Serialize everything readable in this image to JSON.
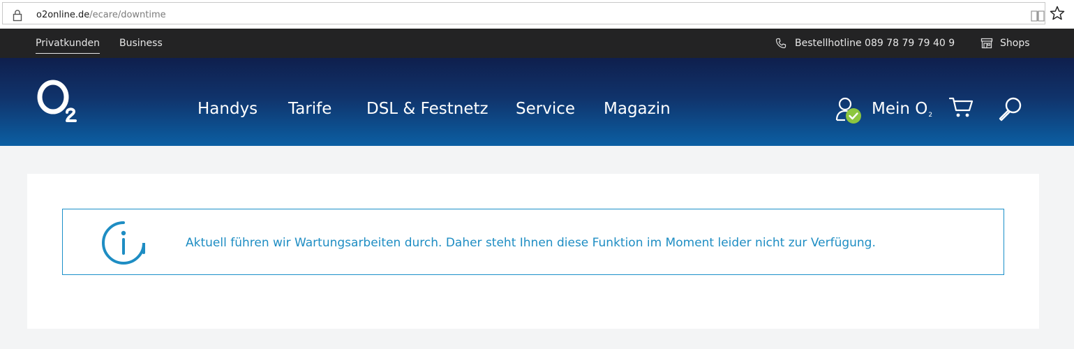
{
  "browser": {
    "url_host": "o2online.de",
    "url_path": "/ecare/downtime"
  },
  "topbar": {
    "segments": [
      "Privatkunden",
      "Business"
    ],
    "hotline": "Bestellhotline 089 78 79 79 40 9",
    "shops": "Shops"
  },
  "header": {
    "nav": [
      "Handys",
      "Tarife",
      "DSL & Festnetz",
      "Service",
      "Magazin"
    ],
    "account_label": "Mein O",
    "account_sub": "2",
    "colors": {
      "brand_blue": "#0b5fa3",
      "check_green": "#8cc63f"
    }
  },
  "notice": {
    "message": "Aktuell führen wir Wartungsarbeiten durch. Daher steht Ihnen diese Funktion im Moment leider nicht zur Verfügung.",
    "icon": "info-icon",
    "color": "#1e8dc3"
  }
}
